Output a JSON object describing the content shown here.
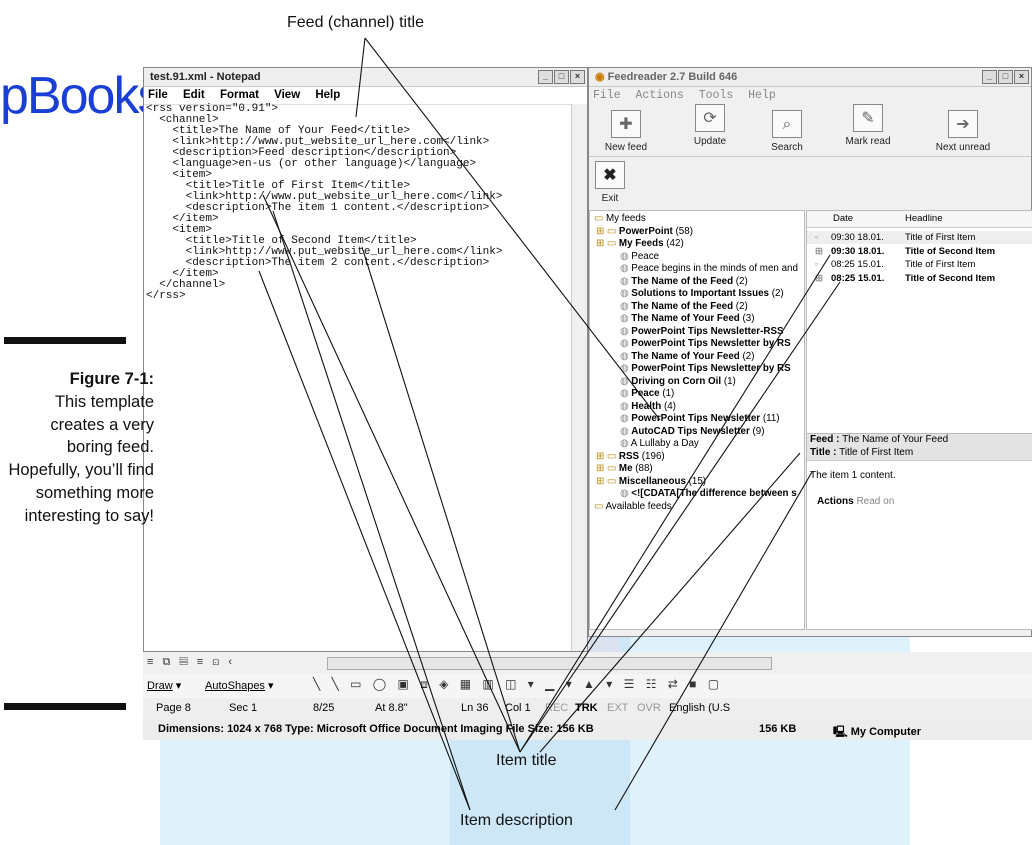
{
  "watermark": {
    "logo_text": "pBooks"
  },
  "callouts": {
    "feed_title": "Feed (channel) title",
    "item_title": "Item title",
    "item_description": "Item description"
  },
  "figure": {
    "label": "Figure 7-1:",
    "text": "This template creates a very boring feed. Hopefully, you’ll find something more interesting to say!"
  },
  "notepad": {
    "title": "test.91.xml - Notepad",
    "menu": [
      "File",
      "Edit",
      "Format",
      "View",
      "Help"
    ],
    "lines": [
      "<rss version=\"0.91\">",
      "  <channel>",
      "    <title>The Name of Your Feed</title>",
      "    <link>http://www.put_website_url_here.com</link>",
      "    <description>Feed description</description>",
      "    <language>en-us (or other language)</language>",
      "    <item>",
      "      <title>Title of First Item</title>",
      "      <link>http://www.put_website_url_here.com</link>",
      "      <description>The item 1 content.</description>",
      "    </item>",
      "    <item>",
      "      <title>Title of Second Item</title>",
      "      <link>http://www.put_website_url_here.com</link>",
      "      <description>The item 2 content.</description>",
      "    </item>",
      "  </channel>",
      "</rss>"
    ]
  },
  "feedreader": {
    "title": "Feedreader 2.7 Build 646",
    "menu": [
      "File",
      "Actions",
      "Tools",
      "Help"
    ],
    "toolbar": [
      "New feed",
      "Update",
      "Search",
      "Mark read",
      "Next unread",
      "Exit"
    ],
    "tree": [
      {
        "label": "My feeds",
        "count": "",
        "level": 0,
        "bold": false
      },
      {
        "label": "PowerPoint",
        "count": "(58)",
        "level": 1,
        "bold": true
      },
      {
        "label": "My Feeds",
        "count": "(42)",
        "level": 1,
        "bold": true
      },
      {
        "label": "Peace",
        "count": "",
        "level": 2,
        "bold": false
      },
      {
        "label": "Peace begins in the minds of men and",
        "count": "",
        "level": 2,
        "bold": false
      },
      {
        "label": "The Name of the Feed",
        "count": "(2)",
        "level": 2,
        "bold": true
      },
      {
        "label": "Solutions to Important Issues",
        "count": "(2)",
        "level": 2,
        "bold": true
      },
      {
        "label": "The Name of the Feed",
        "count": "(2)",
        "level": 2,
        "bold": true
      },
      {
        "label": "The Name of Your Feed",
        "count": "(3)",
        "level": 2,
        "bold": true
      },
      {
        "label": "PowerPoint Tips Newsletter-RSS",
        "count": "",
        "level": 2,
        "bold": true
      },
      {
        "label": "PowerPoint Tips Newsletter by RS",
        "count": "",
        "level": 2,
        "bold": true
      },
      {
        "label": "The Name of Your Feed",
        "count": "(2)",
        "level": 2,
        "bold": true
      },
      {
        "label": "PowerPoint Tips Newsletter by RS",
        "count": "",
        "level": 2,
        "bold": true
      },
      {
        "label": "Driving on Corn Oil",
        "count": "(1)",
        "level": 2,
        "bold": true
      },
      {
        "label": "Peace",
        "count": "(1)",
        "level": 2,
        "bold": true
      },
      {
        "label": "Health",
        "count": "(4)",
        "level": 2,
        "bold": true
      },
      {
        "label": "PowerPoint Tips Newsletter",
        "count": "(11)",
        "level": 2,
        "bold": true
      },
      {
        "label": "AutoCAD Tips Newsletter",
        "count": "(9)",
        "level": 2,
        "bold": true
      },
      {
        "label": "A Lullaby a Day",
        "count": "",
        "level": 2,
        "bold": false
      },
      {
        "label": "RSS",
        "count": "(196)",
        "level": 1,
        "bold": true
      },
      {
        "label": "Me",
        "count": "(88)",
        "level": 1,
        "bold": true
      },
      {
        "label": "Miscellaneous",
        "count": "(15)",
        "level": 1,
        "bold": true
      },
      {
        "label": "<![CDATA[The difference between s",
        "count": "",
        "level": 2,
        "bold": true
      },
      {
        "label": "Available feeds",
        "count": "",
        "level": 0,
        "bold": false
      }
    ],
    "headline_columns": [
      "Date",
      "Headline"
    ],
    "headlines": [
      {
        "date": "09:30 18.01.",
        "headline": "Title of First Item",
        "bold": false
      },
      {
        "date": "09:30 18.01.",
        "headline": "Title of Second Item",
        "bold": true
      },
      {
        "date": "08:25 15.01.",
        "headline": "Title of First Item",
        "bold": false
      },
      {
        "date": "08:25 15.01.",
        "headline": "Title of Second Item",
        "bold": true
      }
    ],
    "preview": {
      "feed_label": "Feed :",
      "feed_value": "The Name of Your Feed",
      "title_label": "Title :",
      "title_value": "Title of First Item",
      "content": "The item 1 content.",
      "actions_label": "Actions",
      "actions_link": "Read on"
    }
  },
  "office": {
    "draw_label": "Draw",
    "autoshapes_label": "AutoShapes",
    "status": [
      "Page 8",
      "Sec 1",
      "8/25",
      "At 8.8\"",
      "Ln 36",
      "Col 1",
      "REC",
      "TRK",
      "EXT",
      "OVR",
      "English (U.S"
    ],
    "explorer_status": {
      "info": "Dimensions: 1024 x 768 Type: Microsoft Office Document Imaging File Size: 156 KB",
      "size": "156 KB",
      "zone": "My Computer"
    }
  }
}
